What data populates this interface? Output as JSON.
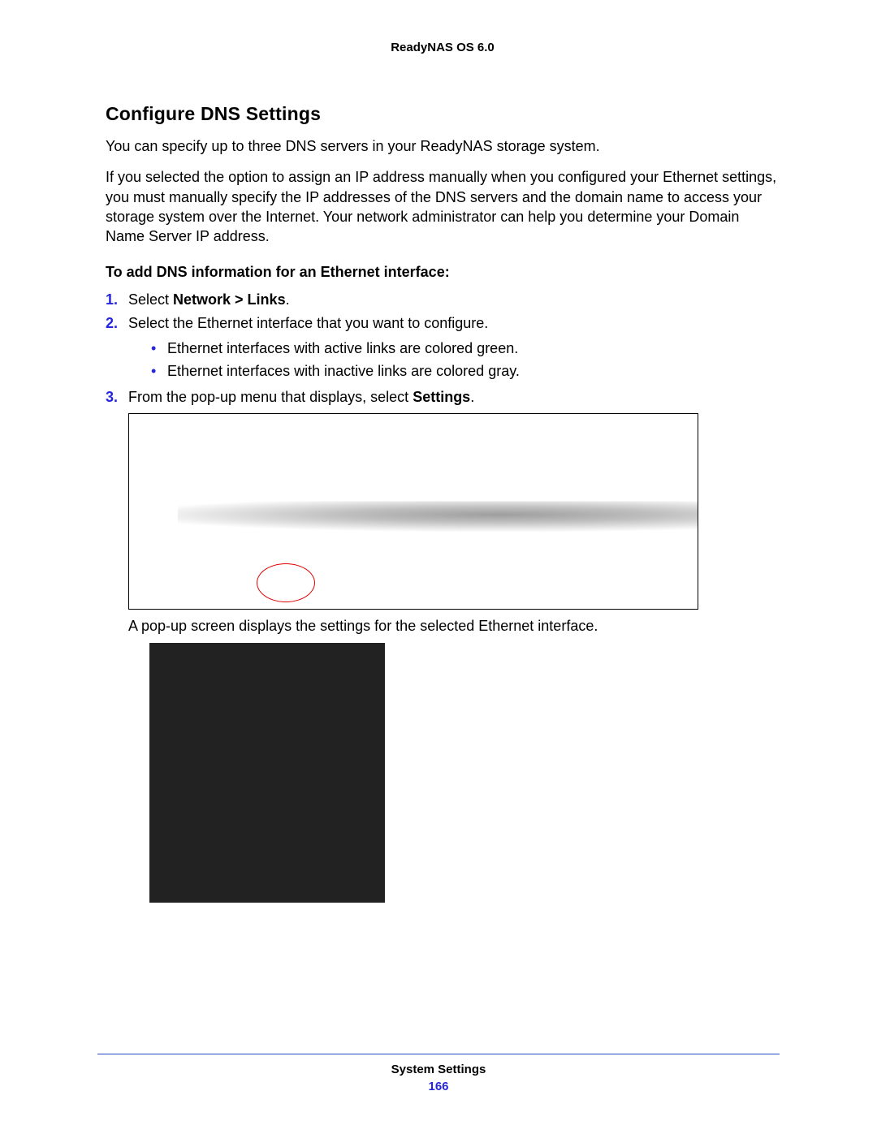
{
  "header": {
    "product": "ReadyNAS OS 6.0"
  },
  "section": {
    "heading": "Configure DNS Settings",
    "para1": "You can specify up to three DNS servers in your ReadyNAS storage system.",
    "para2": "If you selected the option to assign an IP address manually when you configured your Ethernet settings, you must manually specify the IP addresses of the DNS servers and the domain name to access your storage system over the Internet. Your network administrator can help you determine your Domain Name Server IP address.",
    "subheading": "To add DNS information for an Ethernet interface:",
    "steps": {
      "s1_prefix": "Select ",
      "s1_bold": "Network > Links",
      "s1_suffix": ".",
      "s2": "Select the Ethernet interface that you want to configure.",
      "s2_bullets": {
        "b1": "Ethernet interfaces with active links are colored green.",
        "b2": "Ethernet interfaces with inactive links are colored gray."
      },
      "s3_prefix": "From the pop-up menu that displays, select ",
      "s3_bold": "Settings",
      "s3_suffix": "."
    },
    "after_figure": "A pop-up screen displays the settings for the selected Ethernet interface."
  },
  "footer": {
    "section": "System Settings",
    "page": "166"
  }
}
